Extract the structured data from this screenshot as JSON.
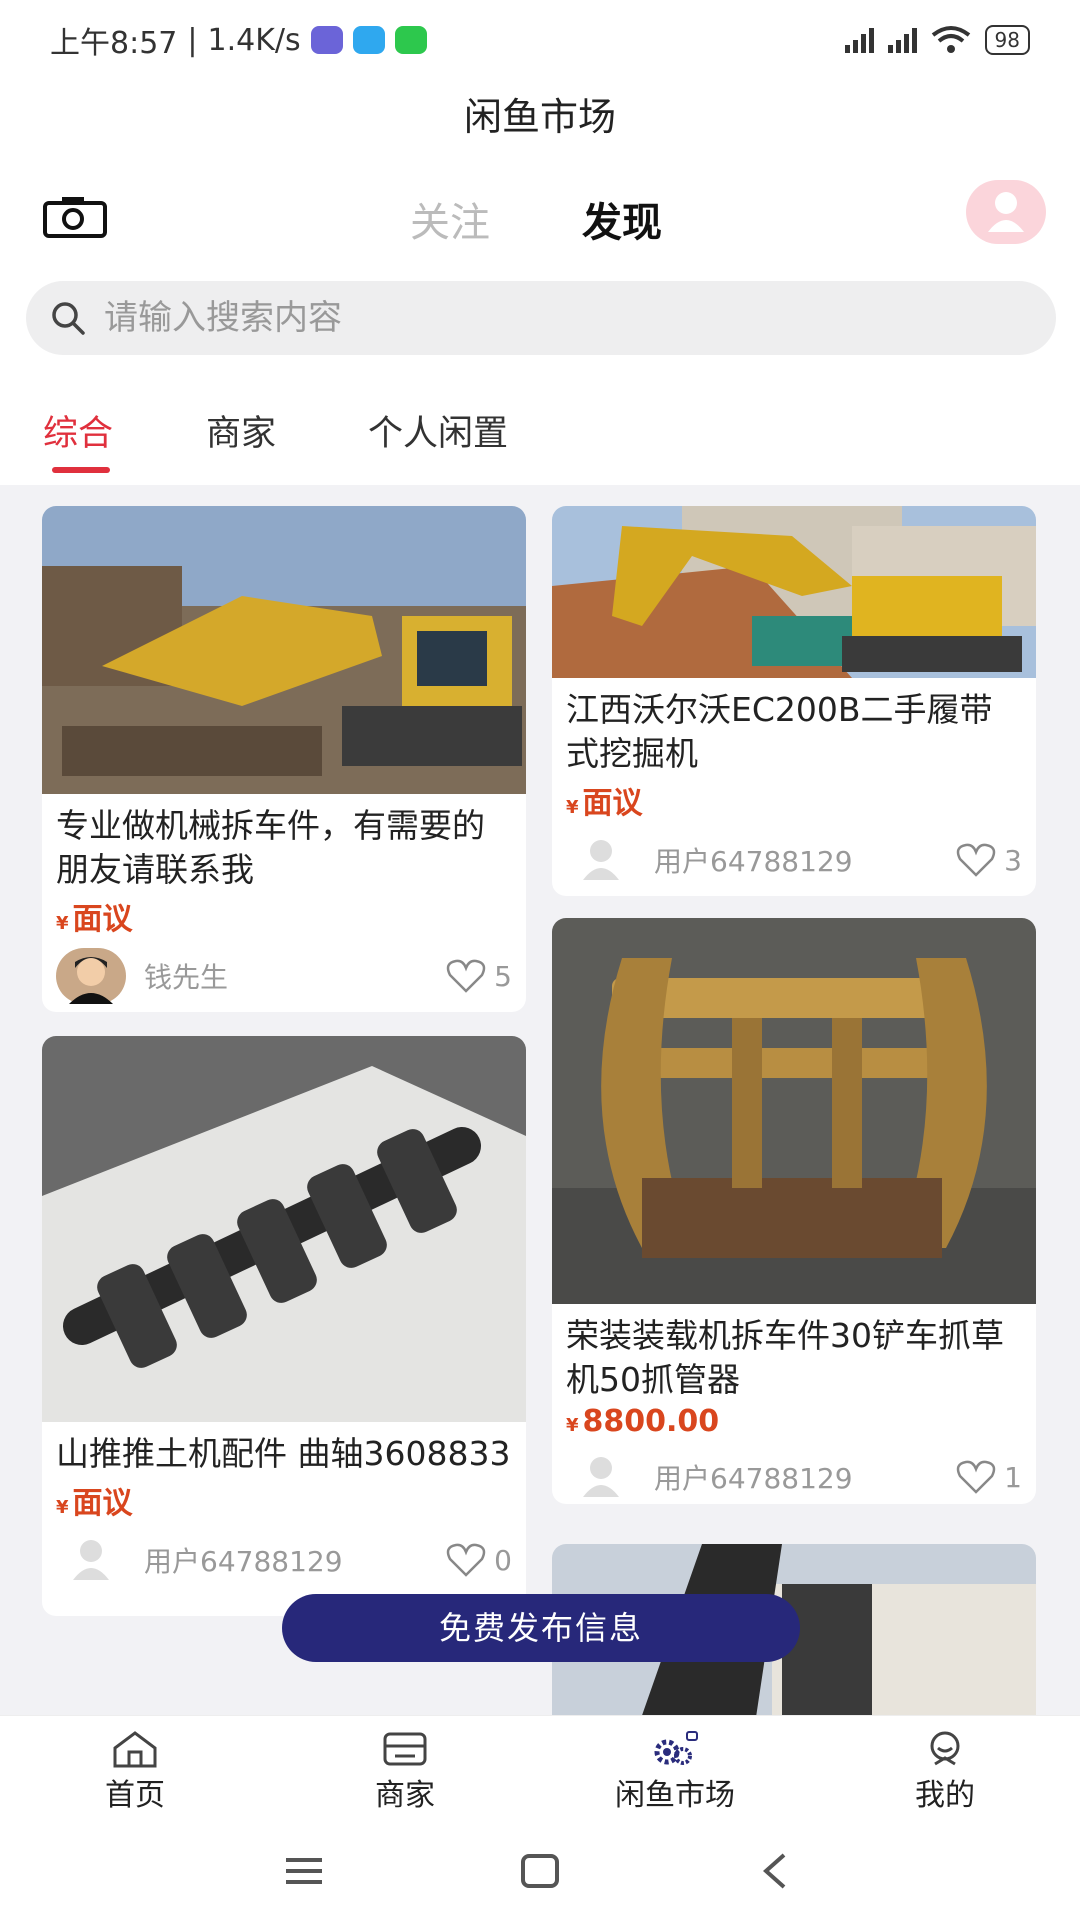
{
  "status_bar": {
    "time": "上午8:57",
    "speed": "1.4K/s",
    "battery": "98"
  },
  "page_title": "闲鱼市场",
  "header": {
    "tab_follow": "关注",
    "tab_discover": "发现"
  },
  "search": {
    "placeholder": "请输入搜索内容"
  },
  "category_tabs": [
    "综合",
    "商家",
    "个人闲置"
  ],
  "posts": [
    {
      "title": "专业做机械拆车件，有需要的朋友请联系我",
      "currency": "¥",
      "price": "面议",
      "user": "钱先生",
      "likes": "5"
    },
    {
      "title": "江西沃尔沃EC200B二手履带式挖掘机",
      "currency": "¥",
      "price": "面议",
      "user": "用户64788129",
      "likes": "3"
    },
    {
      "title": "山推推土机配件 曲轴3608833",
      "currency": "¥",
      "price": "面议",
      "user": "用户64788129",
      "likes": "0"
    },
    {
      "title": "荣装装载机拆车件30铲车抓草机50抓管器",
      "currency": "¥",
      "price": "8800.00",
      "user": "用户64788129",
      "likes": "1"
    }
  ],
  "publish_button": "免费发布信息",
  "bottom_nav": [
    "首页",
    "商家",
    "闲鱼市场",
    "我的"
  ],
  "colors": {
    "accent": "#e0303d",
    "price": "#d9461e",
    "publish": "#27287a"
  }
}
